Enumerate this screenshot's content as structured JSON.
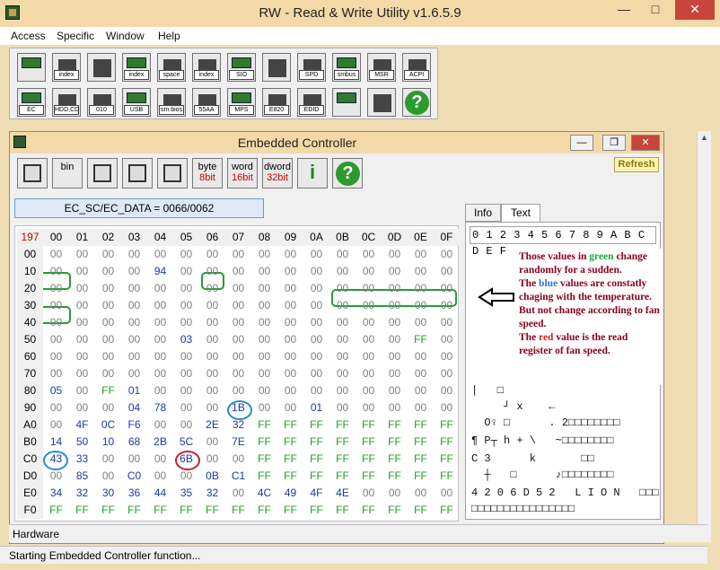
{
  "window": {
    "title": "RW - Read & Write Utility v1.6.5.9"
  },
  "menu": [
    "Access",
    "Specific",
    "Window",
    "Help"
  ],
  "toolbar_row1": [
    "",
    "index",
    "",
    "index",
    "space",
    "index",
    "SIO",
    "",
    "SPD",
    "smbus",
    "MSR",
    "ACPI"
  ],
  "toolbar_row2": [
    "EC",
    "HDD,CD",
    "010",
    "USB",
    "sm bios",
    "55AA",
    "MPS",
    "E820",
    "EDID",
    "",
    "",
    "?"
  ],
  "child": {
    "title": "Embedded Controller",
    "tools": [
      {
        "t1": "",
        "t2": ""
      },
      {
        "t1": "bin",
        "t2": ""
      },
      {
        "t1": "",
        "t2": ""
      },
      {
        "t1": "",
        "t2": ""
      },
      {
        "t1": "",
        "t2": ""
      },
      {
        "t1": "byte",
        "t2": "8bit"
      },
      {
        "t1": "word",
        "t2": "16bit"
      },
      {
        "t1": "dword",
        "t2": "32bit"
      },
      {
        "t1": "i",
        "t2": ""
      },
      {
        "t1": "?",
        "t2": ""
      }
    ],
    "refresh_label": "Refresh",
    "address_label": "EC_SC/EC_DATA = 0066/0062"
  },
  "grid": {
    "corner": "197",
    "cols": [
      "00",
      "01",
      "02",
      "03",
      "04",
      "05",
      "06",
      "07",
      "08",
      "09",
      "0A",
      "0B",
      "0C",
      "0D",
      "0E",
      "0F"
    ],
    "rows": [
      {
        "addr": "00",
        "cells": [
          "00",
          "00",
          "00",
          "00",
          "00",
          "00",
          "00",
          "00",
          "00",
          "00",
          "00",
          "00",
          "00",
          "00",
          "00",
          "00"
        ]
      },
      {
        "addr": "10",
        "cells": [
          "00",
          "00",
          "00",
          "00",
          "94",
          "00",
          "00",
          "00",
          "00",
          "00",
          "00",
          "00",
          "00",
          "00",
          "00",
          "00"
        ]
      },
      {
        "addr": "20",
        "cells": [
          "00",
          "00",
          "00",
          "00",
          "00",
          "00",
          "00",
          "00",
          "00",
          "00",
          "00",
          "00",
          "00",
          "00",
          "00",
          "00"
        ]
      },
      {
        "addr": "30",
        "cells": [
          "00",
          "00",
          "00",
          "00",
          "00",
          "00",
          "00",
          "00",
          "00",
          "00",
          "00",
          "00",
          "00",
          "00",
          "00",
          "00"
        ]
      },
      {
        "addr": "40",
        "cells": [
          "00",
          "00",
          "00",
          "00",
          "00",
          "00",
          "00",
          "00",
          "00",
          "00",
          "00",
          "00",
          "00",
          "00",
          "00",
          "00"
        ]
      },
      {
        "addr": "50",
        "cells": [
          "00",
          "00",
          "00",
          "00",
          "00",
          "03",
          "00",
          "00",
          "00",
          "00",
          "00",
          "00",
          "00",
          "00",
          "FF",
          "00"
        ]
      },
      {
        "addr": "60",
        "cells": [
          "00",
          "00",
          "00",
          "00",
          "00",
          "00",
          "00",
          "00",
          "00",
          "00",
          "00",
          "00",
          "00",
          "00",
          "00",
          "00"
        ]
      },
      {
        "addr": "70",
        "cells": [
          "00",
          "00",
          "00",
          "00",
          "00",
          "00",
          "00",
          "00",
          "00",
          "00",
          "00",
          "00",
          "00",
          "00",
          "00",
          "00"
        ]
      },
      {
        "addr": "80",
        "cells": [
          "05",
          "00",
          "FF",
          "01",
          "00",
          "00",
          "00",
          "00",
          "00",
          "00",
          "00",
          "00",
          "00",
          "00",
          "00",
          "00"
        ]
      },
      {
        "addr": "90",
        "cells": [
          "00",
          "00",
          "00",
          "04",
          "78",
          "00",
          "00",
          "1B",
          "00",
          "00",
          "01",
          "00",
          "00",
          "00",
          "00",
          "00"
        ]
      },
      {
        "addr": "A0",
        "cells": [
          "00",
          "4F",
          "0C",
          "F6",
          "00",
          "00",
          "2E",
          "32",
          "FF",
          "FF",
          "FF",
          "FF",
          "FF",
          "FF",
          "FF",
          "FF"
        ]
      },
      {
        "addr": "B0",
        "cells": [
          "14",
          "50",
          "10",
          "68",
          "2B",
          "5C",
          "00",
          "7E",
          "FF",
          "FF",
          "FF",
          "FF",
          "FF",
          "FF",
          "FF",
          "FF"
        ]
      },
      {
        "addr": "C0",
        "cells": [
          "43",
          "33",
          "00",
          "00",
          "00",
          "6B",
          "00",
          "00",
          "FF",
          "FF",
          "FF",
          "FF",
          "FF",
          "FF",
          "FF",
          "FF"
        ]
      },
      {
        "addr": "D0",
        "cells": [
          "00",
          "85",
          "00",
          "C0",
          "00",
          "00",
          "0B",
          "C1",
          "FF",
          "FF",
          "FF",
          "FF",
          "FF",
          "FF",
          "FF",
          "FF"
        ]
      },
      {
        "addr": "E0",
        "cells": [
          "34",
          "32",
          "30",
          "36",
          "44",
          "35",
          "32",
          "00",
          "4C",
          "49",
          "4F",
          "4E",
          "00",
          "00",
          "00",
          "00"
        ]
      },
      {
        "addr": "F0",
        "cells": [
          "FF",
          "FF",
          "FF",
          "FF",
          "FF",
          "FF",
          "FF",
          "FF",
          "FF",
          "FF",
          "FF",
          "FF",
          "FF",
          "FF",
          "FF",
          "FF"
        ]
      }
    ]
  },
  "tabs": [
    "Info",
    "Text"
  ],
  "text_panel": {
    "header": "0 1 2 3 4 5 6 7 8 9 A B C D E F",
    "rows": [
      "|   □",
      "     ┘ x    ←",
      "  O♀ □      . 2□□□□□□□□",
      "¶ P┬ h + \\   ~□□□□□□□□",
      "C 3      k       □□",
      "  ┼   □      ♪□□□□□□□□",
      "4 2 0 6 D 5 2   L I O N   □□□",
      "□□□□□□□□□□□□□□□□"
    ]
  },
  "note": {
    "p1a": "Those values in ",
    "p1g": "green",
    "p1b": " change randomly for a sudden.",
    "p2a": "The ",
    "p2b": "blue",
    "p2c": " values are constatly chaging with the temperature. But not change according to fan speed.",
    "p3a": "The ",
    "p3r": "red",
    "p3b": " value is the read register of fan speed."
  },
  "hardware_label": "Hardware",
  "status": "Starting Embedded Controller function..."
}
